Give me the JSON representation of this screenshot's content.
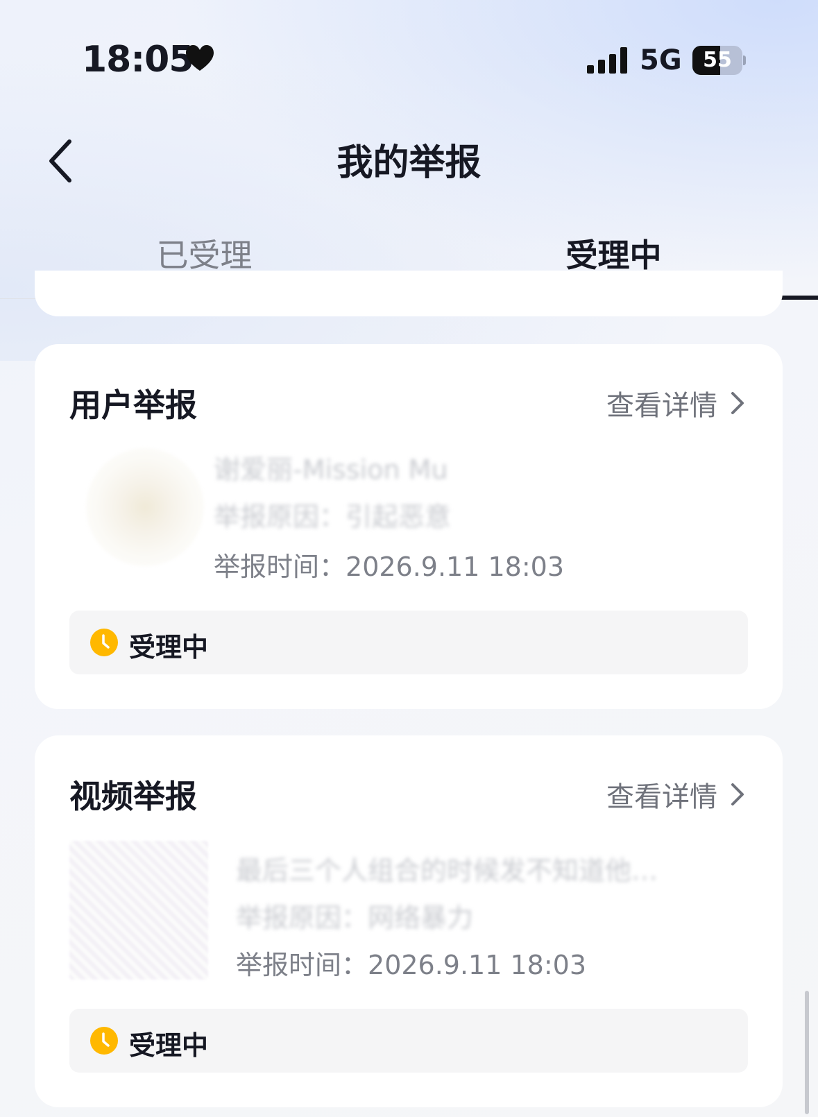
{
  "status_bar": {
    "time": "18:05",
    "network": "5G",
    "battery": "55",
    "battery_level": 0.55,
    "icons": [
      "heart-icon",
      "signal-icon",
      "battery-icon"
    ]
  },
  "header": {
    "title": "我的举报",
    "back_icon": "chevron-left-icon"
  },
  "tabs": [
    {
      "label": "已受理",
      "active": false
    },
    {
      "label": "受理中",
      "active": true
    }
  ],
  "cards": [
    {
      "type_label": "用户举报",
      "detail_label": "查看详情",
      "line1": "谢爱丽-Mission Mu",
      "line2": "举报原因：引起恶意",
      "report_time_label": "举报时间：",
      "report_time": "2026.9.11 18:03",
      "status": "受理中"
    },
    {
      "type_label": "视频举报",
      "detail_label": "查看详情",
      "line1": "最后三个人组合的时候发不知道他…",
      "line2": "举报原因：网络暴力",
      "report_time_label": "举报时间：",
      "report_time": "2026.9.11 18:03",
      "status": "受理中"
    }
  ],
  "colors": {
    "accent_dark": "#161823",
    "status_amber": "#FFB800",
    "muted_text": "#7D8089"
  }
}
